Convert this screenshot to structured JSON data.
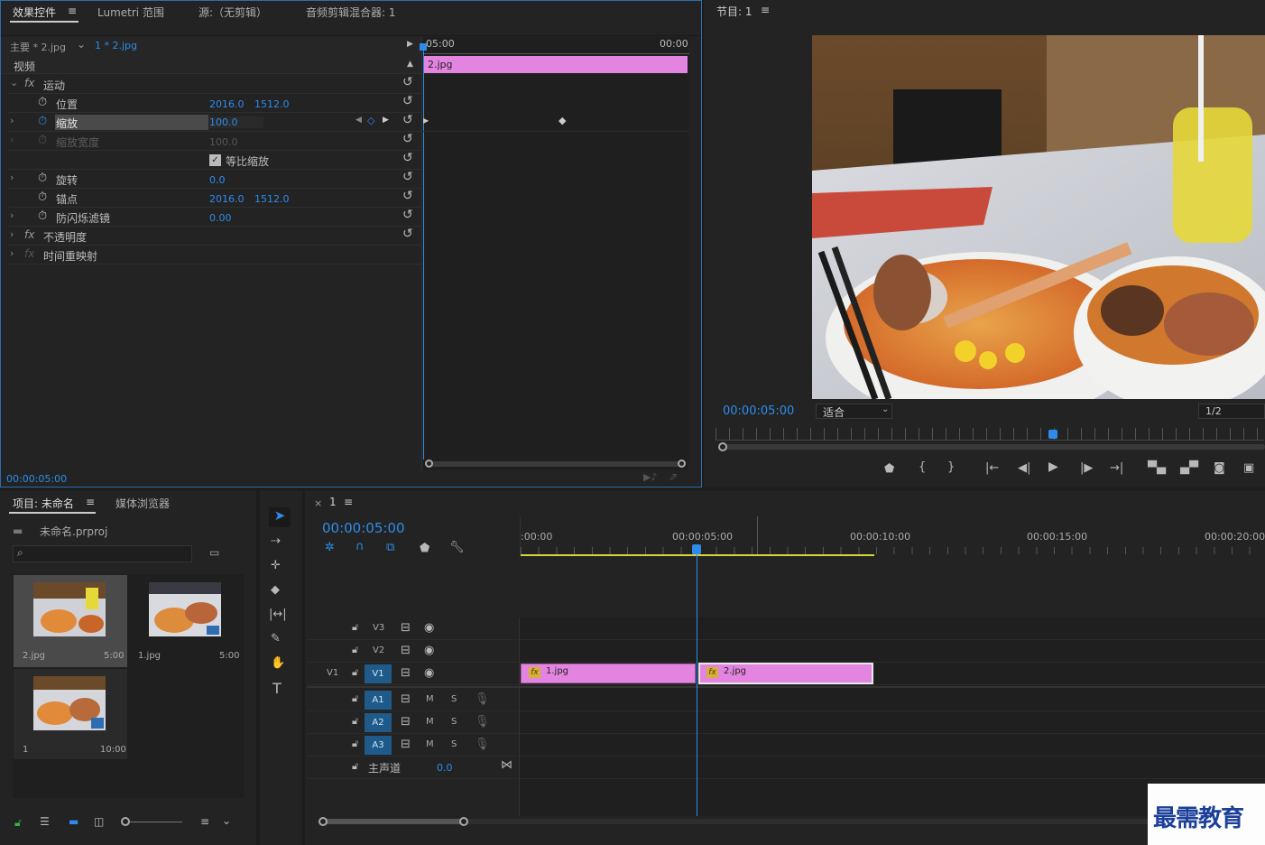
{
  "effect_controls": {
    "tabs": [
      "效果控件",
      "Lumetri 范围",
      "源:（无剪辑）",
      "音频剪辑混合器: 1"
    ],
    "master_label": "主要 * 2.jpg",
    "clip_label": "1 * 2.jpg",
    "section_video": "视频",
    "motion": "运动",
    "properties": {
      "position": {
        "label": "位置",
        "x": "2016.0",
        "y": "1512.0"
      },
      "scale": {
        "label": "缩放",
        "value": "100.0"
      },
      "scale_width": {
        "label": "缩放宽度",
        "value": "100.0"
      },
      "uniform_scale": {
        "label": "等比缩放"
      },
      "rotation": {
        "label": "旋转",
        "value": "0.0"
      },
      "anchor": {
        "label": "锚点",
        "x": "2016.0",
        "y": "1512.0"
      },
      "flicker": {
        "label": "防闪烁滤镜",
        "value": "0.00"
      }
    },
    "opacity": "不透明度",
    "time_remap": "时间重映射",
    "timecode": "00:00:05:00",
    "mini_timeline": {
      "start": "05:00",
      "end": "00:00",
      "clip": "2.jpg"
    }
  },
  "program_monitor": {
    "title": "节目: 1",
    "timecode": "00:00:05:00",
    "fit_label": "适合",
    "resolution": "1/2"
  },
  "project": {
    "tab_project": "项目: 未命名",
    "tab_media": "媒体浏览器",
    "file_name": "未命名.prproj",
    "items": [
      {
        "name": "2.jpg",
        "duration": "5:00"
      },
      {
        "name": "1.jpg",
        "duration": "5:00"
      },
      {
        "name": "1",
        "duration": "10:00"
      }
    ]
  },
  "timeline": {
    "tab": "1",
    "timecode": "00:00:05:00",
    "ruler": [
      ":00:00",
      "00:00:05:00",
      "00:00:10:00",
      "00:00:15:00",
      "00:00:20:00"
    ],
    "video_tracks": [
      "V3",
      "V2",
      "V1"
    ],
    "audio_tracks": [
      "A1",
      "A2",
      "A3"
    ],
    "source_patch": "V1",
    "mute_label": "M",
    "solo_label": "S",
    "master_label": "主声道",
    "master_value": "0.0",
    "clips": [
      {
        "name": "1.jpg",
        "start": 0,
        "end": 5
      },
      {
        "name": "2.jpg",
        "start": 5,
        "end": 10
      }
    ]
  },
  "watermark": "最需教育",
  "colors": {
    "accent": "#2d8ceb",
    "clip": "#e384e0",
    "panel": "#232323"
  }
}
